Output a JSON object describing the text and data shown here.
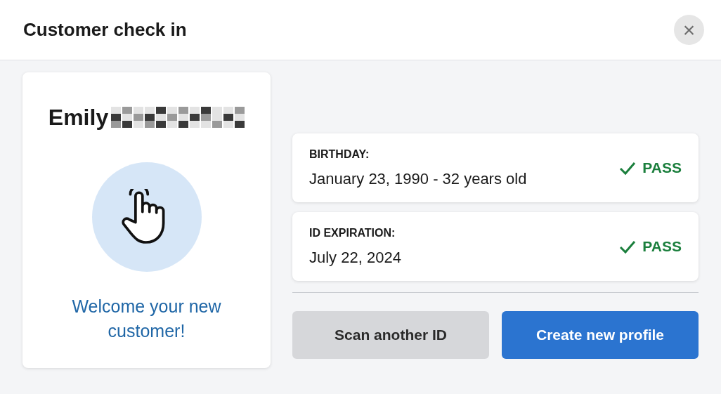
{
  "window": {
    "title": "Customer check in",
    "close_label": "×"
  },
  "customer": {
    "first_name": "Emily",
    "name_redacted": true,
    "message": "Welcome your new customer!"
  },
  "checks": [
    {
      "label": "BIRTHDAY:",
      "value": "January 23, 1990 - 32 years old",
      "passed": true,
      "result": "PASS"
    },
    {
      "label": "ID EXPIRATION:",
      "value": "July 22, 2024",
      "passed": true,
      "result": "PASS"
    }
  ],
  "buttons": [
    {
      "label": "Scan another ID",
      "kind": "secondary"
    },
    {
      "label": "Create new profile",
      "kind": "primary"
    }
  ]
}
